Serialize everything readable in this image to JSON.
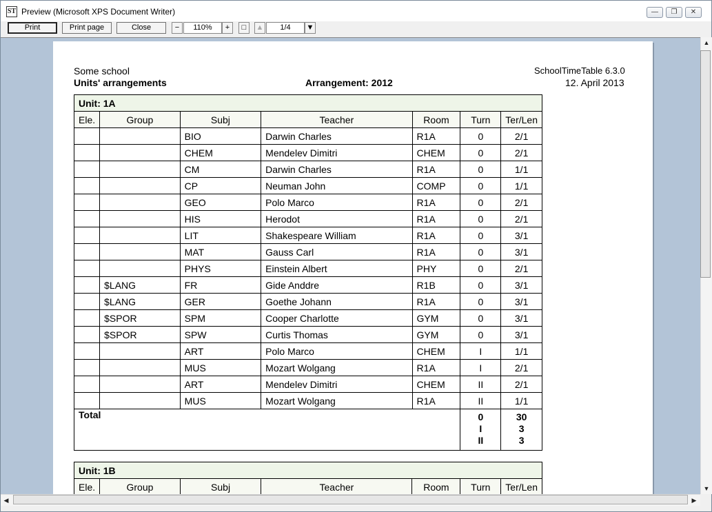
{
  "window": {
    "title": "Preview (Microsoft XPS Document Writer)",
    "icon": "schooltimetable-app-icon",
    "minimize": "minimize",
    "restore": "restore",
    "close": "close"
  },
  "toolbar": {
    "print": "Print",
    "print_page": "Print page",
    "close": "Close",
    "zoom_minus": "−",
    "zoom_value": "110%",
    "zoom_plus": "+",
    "fit": "□",
    "prev": "▲",
    "page_value": "1/4",
    "page_dropdown": "▼"
  },
  "document": {
    "school": "Some school",
    "report_title": "Units' arrangements",
    "arrangement": "Arrangement: 2012",
    "app_version": "SchoolTimeTable 6.3.0",
    "date": "12. April 2013",
    "columns": [
      "Ele.",
      "Group",
      "Subj",
      "Teacher",
      "Room",
      "Turn",
      "Ter/Len"
    ],
    "units": [
      {
        "title": "Unit: 1A",
        "rows": [
          [
            "",
            "",
            "BIO",
            "Darwin Charles",
            "R1A",
            "0",
            "2/1"
          ],
          [
            "",
            "",
            "CHEM",
            "Mendelev Dimitri",
            "CHEM",
            "0",
            "2/1"
          ],
          [
            "",
            "",
            "CM",
            "Darwin Charles",
            "R1A",
            "0",
            "1/1"
          ],
          [
            "",
            "",
            "CP",
            "Neuman John",
            "COMP",
            "0",
            "1/1"
          ],
          [
            "",
            "",
            "GEO",
            "Polo Marco",
            "R1A",
            "0",
            "2/1"
          ],
          [
            "",
            "",
            "HIS",
            "Herodot",
            "R1A",
            "0",
            "2/1"
          ],
          [
            "",
            "",
            "LIT",
            "Shakespeare William",
            "R1A",
            "0",
            "3/1"
          ],
          [
            "",
            "",
            "MAT",
            "Gauss Carl",
            "R1A",
            "0",
            "3/1"
          ],
          [
            "",
            "",
            "PHYS",
            "Einstein Albert",
            "PHY",
            "0",
            "2/1"
          ],
          [
            "",
            "$LANG",
            "FR",
            "Gide Anddre",
            "R1B",
            "0",
            "3/1"
          ],
          [
            "",
            "$LANG",
            "GER",
            "Goethe Johann",
            "R1A",
            "0",
            "3/1"
          ],
          [
            "",
            "$SPOR",
            "SPM",
            "Cooper Charlotte",
            "GYM",
            "0",
            "3/1"
          ],
          [
            "",
            "$SPOR",
            "SPW",
            "Curtis Thomas",
            "GYM",
            "0",
            "3/1"
          ],
          [
            "",
            "",
            "ART",
            "Polo Marco",
            "CHEM",
            "I",
            "1/1"
          ],
          [
            "",
            "",
            "MUS",
            "Mozart Wolgang",
            "R1A",
            "I",
            "2/1"
          ],
          [
            "",
            "",
            "ART",
            "Mendelev Dimitri",
            "CHEM",
            "II",
            "2/1"
          ],
          [
            "",
            "",
            "MUS",
            "Mozart Wolgang",
            "R1A",
            "II",
            "1/1"
          ]
        ],
        "total_label": "Total",
        "totals": [
          {
            "turn": "0",
            "value": "30"
          },
          {
            "turn": "I",
            "value": "3"
          },
          {
            "turn": "II",
            "value": "3"
          }
        ]
      },
      {
        "title": "Unit: 1B",
        "rows": []
      }
    ]
  }
}
